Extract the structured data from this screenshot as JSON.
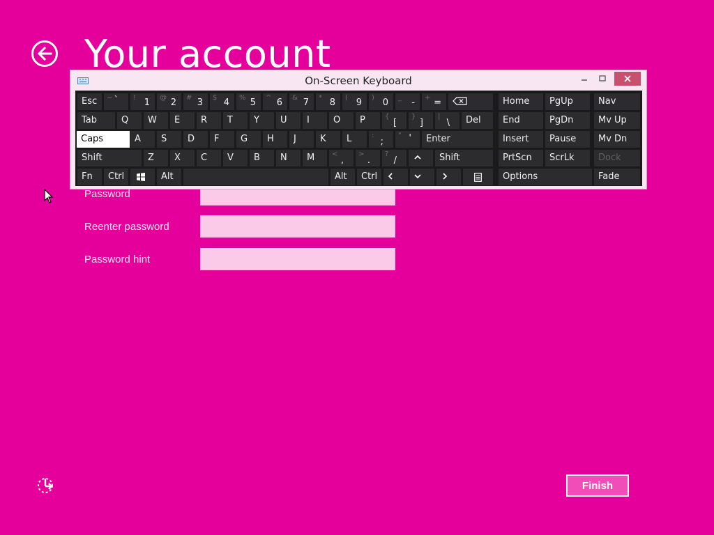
{
  "header": {
    "title": "Your account"
  },
  "form": {
    "fields": [
      {
        "label": "Password",
        "value": ""
      },
      {
        "label": "Reenter password",
        "value": ""
      },
      {
        "label": "Password hint",
        "value": ""
      }
    ]
  },
  "footer": {
    "finish_label": "Finish"
  },
  "osk": {
    "title": "On-Screen Keyboard",
    "keys": {
      "esc": "Esc",
      "row1": [
        {
          "s": "~",
          "m": "`"
        },
        {
          "s": "!",
          "m": "1"
        },
        {
          "s": "@",
          "m": "2"
        },
        {
          "s": "#",
          "m": "3"
        },
        {
          "s": "$",
          "m": "4"
        },
        {
          "s": "%",
          "m": "5"
        },
        {
          "s": "^",
          "m": "6"
        },
        {
          "s": "&",
          "m": "7"
        },
        {
          "s": "*",
          "m": "8"
        },
        {
          "s": "(",
          "m": "9"
        },
        {
          "s": ")",
          "m": "0"
        },
        {
          "s": "_",
          "m": "-"
        },
        {
          "s": "+",
          "m": "="
        }
      ],
      "tab": "Tab",
      "row2": [
        "Q",
        "W",
        "E",
        "R",
        "T",
        "Y",
        "U",
        "I",
        "O",
        "P"
      ],
      "row2_sym": [
        {
          "s": "{",
          "m": "["
        },
        {
          "s": "}",
          "m": "]"
        },
        {
          "s": "|",
          "m": "\\"
        }
      ],
      "del": "Del",
      "caps": "Caps",
      "row3": [
        "A",
        "S",
        "D",
        "F",
        "G",
        "H",
        "J",
        "K",
        "L"
      ],
      "row3_sym": [
        {
          "s": ":",
          "m": ";"
        },
        {
          "s": "\"",
          "m": "'"
        }
      ],
      "enter": "Enter",
      "shift": "Shift",
      "row4": [
        "Z",
        "X",
        "C",
        "V",
        "B",
        "N",
        "M"
      ],
      "row4_sym": [
        {
          "s": "<",
          "m": ","
        },
        {
          "s": ">",
          "m": "."
        },
        {
          "s": "?",
          "m": "/"
        }
      ],
      "fn": "Fn",
      "ctrl": "Ctrl",
      "alt": "Alt",
      "nav": {
        "home": "Home",
        "pgup": "PgUp",
        "nav": "Nav",
        "end": "End",
        "pgdn": "PgDn",
        "mvup": "Mv Up",
        "insert": "Insert",
        "pause": "Pause",
        "mvdn": "Mv Dn",
        "prtscn": "PrtScn",
        "scrlk": "ScrLk",
        "dock": "Dock",
        "options": "Options",
        "fade": "Fade"
      }
    }
  },
  "colors": {
    "background": "#e5009b",
    "input": "#fbcae9",
    "key": "#2c2c2e",
    "keyboard": "#1a1a1a"
  }
}
